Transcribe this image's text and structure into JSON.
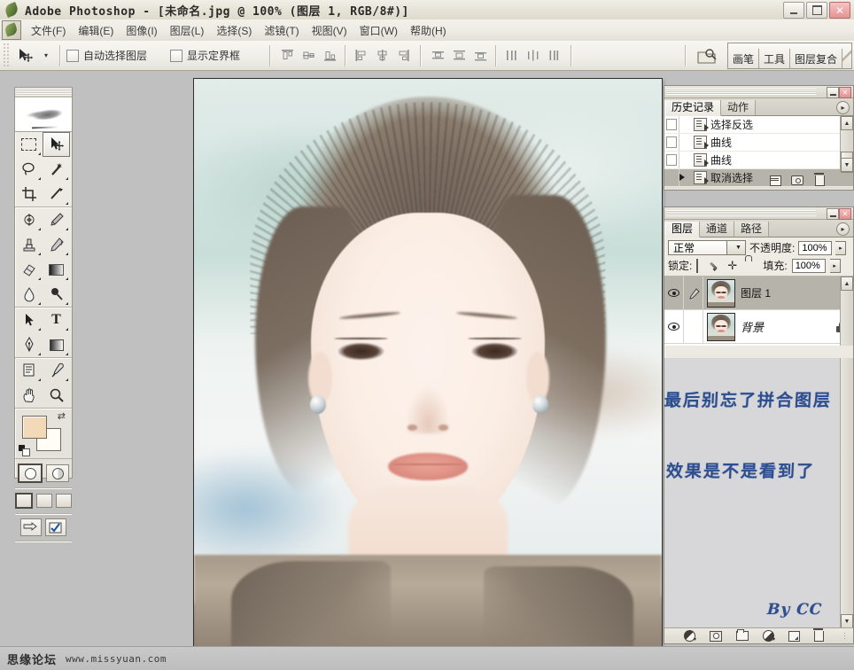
{
  "window": {
    "title": "Adobe Photoshop - [未命名.jpg @ 100% (图层 1, RGB/8#)]",
    "minimize_label": "",
    "maximize_label": "",
    "close_label": "✕",
    "app_icon": "photoshop-feather-icon"
  },
  "menubar": {
    "items": [
      {
        "label": "文件(F)"
      },
      {
        "label": "编辑(E)"
      },
      {
        "label": "图像(I)"
      },
      {
        "label": "图层(L)"
      },
      {
        "label": "选择(S)"
      },
      {
        "label": "滤镜(T)"
      },
      {
        "label": "视图(V)"
      },
      {
        "label": "窗口(W)"
      },
      {
        "label": "帮助(H)"
      }
    ]
  },
  "options_bar": {
    "tool_icon": "move-tool-icon",
    "tool_preset_caret": "▾",
    "auto_select_layer": {
      "label": "自动选择图层",
      "checked": false
    },
    "show_bounding_box": {
      "label": "显示定界框",
      "checked": false
    },
    "align_buttons": [
      {
        "name": "align-top-edges"
      },
      {
        "name": "align-vertical-centers"
      },
      {
        "name": "align-bottom-edges"
      },
      {
        "name": "align-left-edges"
      },
      {
        "name": "align-horizontal-centers"
      },
      {
        "name": "align-right-edges"
      }
    ],
    "distribute_buttons": [
      {
        "name": "distribute-top-edges"
      },
      {
        "name": "distribute-vertical-centers"
      },
      {
        "name": "distribute-bottom-edges"
      },
      {
        "name": "distribute-left-edges"
      },
      {
        "name": "distribute-horizontal-centers"
      },
      {
        "name": "distribute-right-edges"
      }
    ],
    "file_browser_icon": "file-browser-icon",
    "palette_well": [
      {
        "label": "画笔"
      },
      {
        "label": "工具"
      },
      {
        "label": "图层复合"
      }
    ]
  },
  "toolbox": {
    "logo_icon": "feather-logo-icon",
    "tools": [
      [
        {
          "name": "rectangular-marquee-tool",
          "selected": false
        },
        {
          "name": "move-tool",
          "selected": true
        },
        {
          "name": "lasso-tool",
          "selected": false
        },
        {
          "name": "magic-wand-tool",
          "selected": false
        },
        {
          "name": "crop-tool",
          "selected": false
        },
        {
          "name": "slice-tool",
          "selected": false
        }
      ],
      [
        {
          "name": "healing-brush-tool",
          "selected": false
        },
        {
          "name": "brush-tool",
          "selected": false
        },
        {
          "name": "clone-stamp-tool",
          "selected": false
        },
        {
          "name": "history-brush-tool",
          "selected": false
        },
        {
          "name": "eraser-tool",
          "selected": false
        },
        {
          "name": "gradient-tool",
          "selected": false
        },
        {
          "name": "blur-tool",
          "selected": false
        },
        {
          "name": "dodge-tool",
          "selected": false
        }
      ],
      [
        {
          "name": "path-selection-tool",
          "selected": false
        },
        {
          "name": "type-tool",
          "selected": false
        },
        {
          "name": "pen-tool",
          "selected": false
        },
        {
          "name": "rectangle-shape-tool",
          "selected": false
        }
      ],
      [
        {
          "name": "notes-tool",
          "selected": false
        },
        {
          "name": "eyedropper-tool",
          "selected": false
        },
        {
          "name": "hand-tool",
          "selected": false
        },
        {
          "name": "zoom-tool",
          "selected": false
        }
      ]
    ],
    "colors": {
      "foreground": "#f2d9b8",
      "background": "#fffdf5",
      "swap_icon": "swap-colors-icon",
      "default_icon": "default-colors-icon"
    },
    "mask_modes": [
      {
        "name": "standard-mode",
        "selected": true
      },
      {
        "name": "quick-mask-mode",
        "selected": false
      }
    ],
    "screen_modes": [
      {
        "name": "standard-screen-mode",
        "selected": true
      },
      {
        "name": "full-screen-with-menubar",
        "selected": false
      },
      {
        "name": "full-screen-mode",
        "selected": false
      }
    ],
    "jump_buttons": [
      {
        "name": "jump-to-imageready"
      },
      {
        "name": "jump-to-other-app"
      }
    ]
  },
  "history_palette": {
    "tabs": [
      {
        "label": "历史记录",
        "active": true
      },
      {
        "label": "动作",
        "active": false
      }
    ],
    "menu_arrow": "▸",
    "minimize_label": "",
    "close_label": "✕",
    "rows": [
      {
        "label": "选择反选",
        "current": false
      },
      {
        "label": "曲线",
        "current": false
      },
      {
        "label": "曲线",
        "current": false
      },
      {
        "label": "取消选择",
        "current": true
      }
    ],
    "footer_buttons": [
      {
        "name": "create-document-from-state-button"
      },
      {
        "name": "create-new-snapshot-button"
      },
      {
        "name": "delete-state-button"
      }
    ]
  },
  "layers_palette": {
    "tabs": [
      {
        "label": "图层",
        "active": true
      },
      {
        "label": "通道",
        "active": false
      },
      {
        "label": "路径",
        "active": false
      }
    ],
    "menu_arrow": "▸",
    "minimize_label": "",
    "close_label": "✕",
    "blend_mode": {
      "value": "正常",
      "caret": "▾"
    },
    "opacity": {
      "label": "不透明度:",
      "value": "100%",
      "caret": "▸"
    },
    "lock": {
      "label": "锁定:",
      "toggles": [
        {
          "name": "lock-transparent-pixels"
        },
        {
          "name": "lock-image-pixels"
        },
        {
          "name": "lock-position"
        },
        {
          "name": "lock-all"
        }
      ]
    },
    "fill": {
      "label": "填充:",
      "value": "100%",
      "caret": "▸"
    },
    "layers": [
      {
        "name": "图层 1",
        "visible": true,
        "selected": true,
        "linked_or_brush": "brush-icon",
        "locked": false
      },
      {
        "name": "背景",
        "visible": true,
        "selected": false,
        "linked_or_brush": "",
        "locked": true
      }
    ],
    "footer_buttons": [
      {
        "name": "layer-style-button"
      },
      {
        "name": "add-layer-mask-button"
      },
      {
        "name": "new-group-button"
      },
      {
        "name": "new-adjustment-layer-button"
      },
      {
        "name": "new-layer-button"
      },
      {
        "name": "delete-layer-button"
      }
    ]
  },
  "annotations": {
    "line1": "最后别忘了拼合图层",
    "line2": "效果是不是看到了",
    "signature": "By CC"
  },
  "watermark": {
    "forum": "思缘论坛",
    "url": "www.missyuan.com"
  },
  "canvas": {
    "zoom": "100%",
    "document_name": "未命名.jpg",
    "color_mode": "RGB/8#",
    "active_layer": "图层 1"
  }
}
